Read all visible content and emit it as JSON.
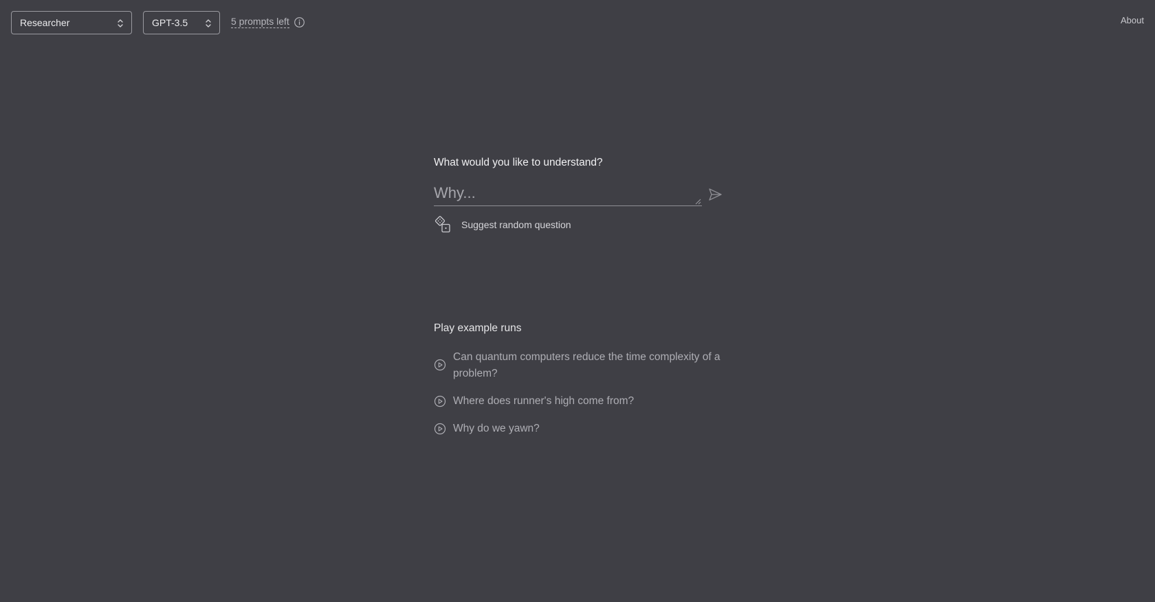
{
  "header": {
    "role_select": {
      "value": "Researcher"
    },
    "model_select": {
      "value": "GPT-3.5"
    },
    "prompts_left": "5 prompts left",
    "about_link": "About"
  },
  "main": {
    "question_label": "What would you like to understand?",
    "input": {
      "placeholder": "Why...",
      "value": ""
    },
    "suggest_label": "Suggest random question",
    "examples_title": "Play example runs",
    "examples": [
      "Can quantum computers reduce the time complexity of a problem?",
      "Where does runner's high come from?",
      "Why do we yawn?"
    ]
  },
  "icons": {
    "select_chevron": "chevron-up-down-icon",
    "info": "info-icon",
    "send": "send-icon",
    "dice": "dice-icon",
    "play": "play-circle-icon"
  },
  "colors": {
    "background": "#3f3f45",
    "text_primary": "#f0f0f2",
    "text_muted": "#aeaeb4",
    "border": "#9a9aa0"
  }
}
